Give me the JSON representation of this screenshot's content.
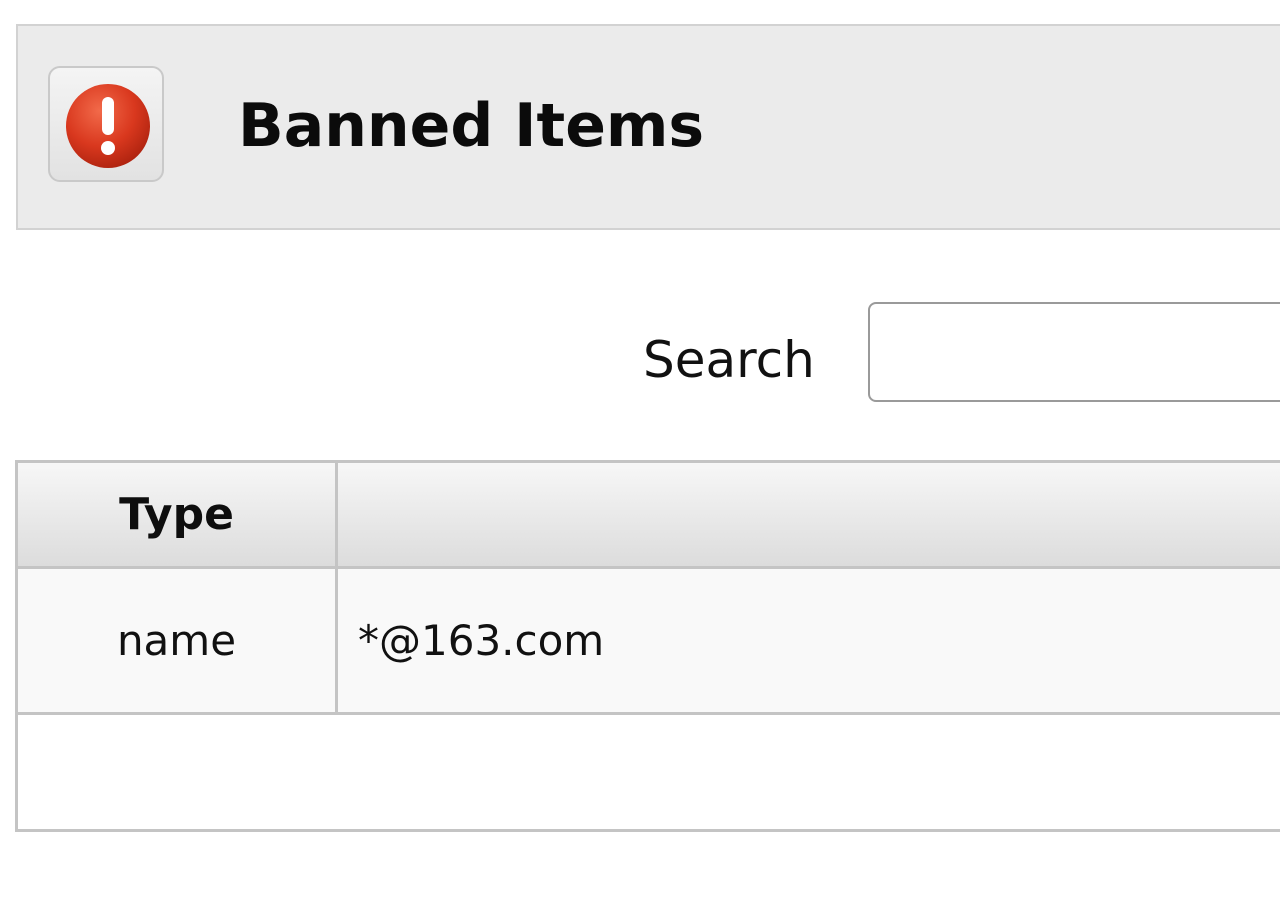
{
  "header": {
    "title": "Banned Items",
    "icon": "exclamation-icon",
    "icon_color": "#d9381e"
  },
  "search": {
    "label": "Search",
    "value": "",
    "placeholder": ""
  },
  "table": {
    "columns": [
      "Type",
      ""
    ],
    "rows": [
      {
        "type": "name",
        "value": "*@163.com"
      }
    ]
  }
}
